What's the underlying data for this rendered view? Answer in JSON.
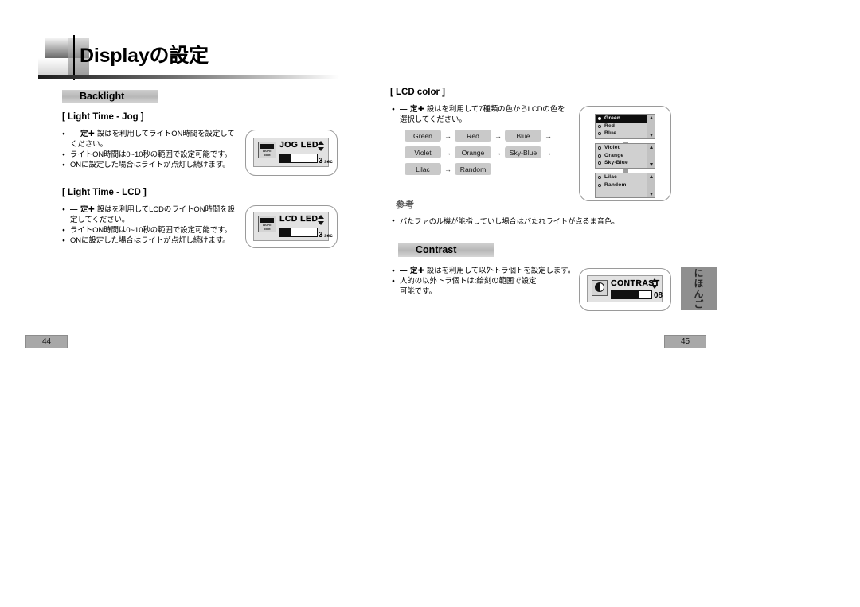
{
  "header": {
    "title": "Displayの設定",
    "logo_icon": "gradient-blocks-logo"
  },
  "left_page": {
    "page_number": "44",
    "section": {
      "label": "Backlight"
    },
    "blocks": [
      {
        "heading": "[ Light Time - Jog ]",
        "bullets": [
          {
            "prefix": "— 定✚",
            "text": "設はを利用してライトON時間を設定して",
            "cont": "ください。"
          },
          {
            "prefix": "",
            "text": "ライトON時間は0~10秒の範囲で設定可能です。",
            "cont": ""
          },
          {
            "prefix": "",
            "text": "ONに設定した場合はライトが点灯し続けます。",
            "cont": ""
          }
        ],
        "device": {
          "icon_label_line1": "LIGHT",
          "icon_label_line2": "TIME",
          "title": "JOG LED",
          "value": "3",
          "unit": "sec",
          "gauge_percent": 28
        }
      },
      {
        "heading": "[ Light Time - LCD ]",
        "bullets": [
          {
            "prefix": "— 定✚",
            "text": "設はを利用してLCDのライトON時間を設",
            "cont": "定してください。"
          },
          {
            "prefix": "",
            "text": "ライトON時間は0~10秒の範囲で設定可能です。",
            "cont": ""
          },
          {
            "prefix": "",
            "text": "ONに設定した場合はライトが点灯し続けます。",
            "cont": ""
          }
        ],
        "device": {
          "icon_label_line1": "LIGHT",
          "icon_label_line2": "TIME",
          "title": "LCD LED",
          "value": "3",
          "unit": "sec",
          "gauge_percent": 28
        }
      }
    ]
  },
  "right_page": {
    "page_number": "45",
    "lcd_color": {
      "heading": "[ LCD color ]",
      "bullets": [
        {
          "prefix": "— 定✚",
          "text": "設はを利用して7種類の色からLCDの色を",
          "cont": "選択してください。"
        }
      ],
      "flow_rows": [
        {
          "items": [
            "Green",
            "Red",
            "Blue"
          ],
          "trailing_arrow": true
        },
        {
          "items": [
            "Violet",
            "Orange",
            "Sky-Blue"
          ],
          "trailing_arrow": true
        },
        {
          "items": [
            "Lilac",
            "Random"
          ],
          "trailing_arrow": false
        }
      ],
      "arrow_glyph": "→",
      "device_lists": [
        {
          "items": [
            "Green",
            "Red",
            "Blue"
          ],
          "selected": "Green"
        },
        {
          "items": [
            "Violet",
            "Orange",
            "Sky-Blue"
          ],
          "selected": ""
        },
        {
          "items": [
            "Lilac",
            "Random"
          ],
          "selected": ""
        }
      ]
    },
    "note": {
      "title": "参考",
      "lines": [
        "バたファのル機が能指していし場合はバたれライトが点るま音色。"
      ]
    },
    "contrast": {
      "section_label": "Contrast",
      "bullets": [
        {
          "prefix": "— 定✚",
          "text": "設はを利用して以外トラ個トを設定します。",
          "cont": ""
        },
        {
          "prefix": "",
          "text": "人的の以外トラ個トは:給刻の範囲で設定",
          "cont": "可能です。"
        }
      ],
      "device": {
        "title": "CONTRAST",
        "value": "08",
        "gauge_percent": 68,
        "icon": "contrast-half-circle"
      }
    },
    "side_tab": {
      "label": "にほんご"
    }
  }
}
